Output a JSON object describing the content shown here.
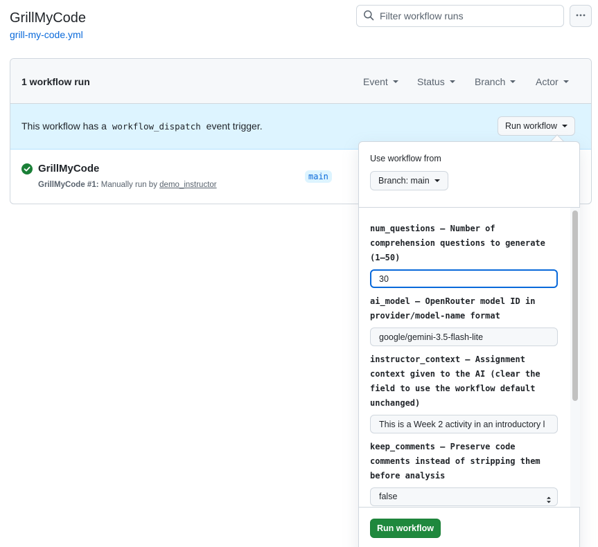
{
  "header": {
    "title": "GrillMyCode",
    "file": "grill-my-code.yml",
    "filter_placeholder": "Filter workflow runs"
  },
  "runs": {
    "count_label": "1 workflow run",
    "filters": [
      "Event",
      "Status",
      "Branch",
      "Actor"
    ]
  },
  "banner": {
    "text_before": "This workflow has a",
    "code": "workflow_dispatch",
    "text_after": "event trigger.",
    "button_label": "Run workflow"
  },
  "run_item": {
    "name": "GrillMyCode",
    "meta_prefix": "GrillMyCode #1:",
    "meta_text": "Manually run by",
    "actor": "demo_instructor",
    "branch": "main"
  },
  "dispatch": {
    "use_from_label": "Use workflow from",
    "branch_label": "Branch: main",
    "fields": [
      {
        "label": "num_questions – Number of comprehension questions to generate (1–50)",
        "value": "30"
      },
      {
        "label": "ai_model – OpenRouter model ID in provider/model-name format",
        "value": "google/gemini-3.5-flash-lite"
      },
      {
        "label": "instructor_context – Assignment context given to the AI (clear the field to use the workflow default unchanged)",
        "value": "This is a Week 2 activity in an introductory l"
      },
      {
        "label": "keep_comments – Preserve code comments instead of stripping them before analysis",
        "value": "false"
      }
    ],
    "submit_label": "Run workflow"
  },
  "colors": {
    "link": "#0969da",
    "success": "#1a7f37",
    "primary_button": "#1f883d",
    "banner_bg": "#ddf4ff"
  },
  "icons": {
    "search": "search-icon",
    "kebab": "kebab-horizontal-icon",
    "check": "check-circle-fill-icon"
  }
}
